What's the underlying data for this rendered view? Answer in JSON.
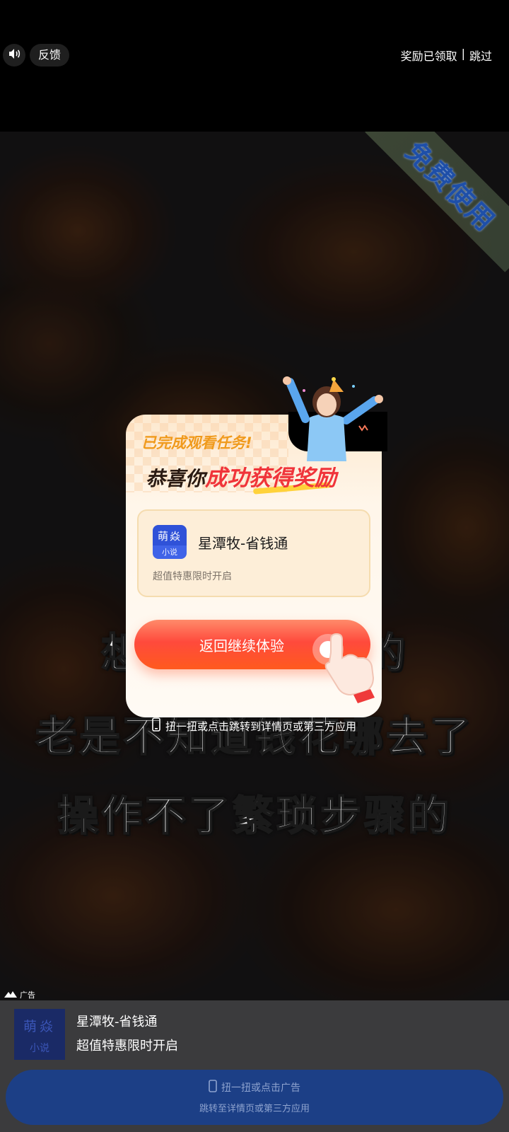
{
  "topbar": {
    "sound_icon": "speaker-icon",
    "feedback_label": "反馈",
    "reward_status": "奖励已领取",
    "separator": "|",
    "skip_label": "跳过"
  },
  "video": {
    "ribbon_text": "免费使用",
    "captions": [
      "想把钱存起来的",
      "老是不知道钱花哪去了",
      "操作不了繁琐步骤的"
    ],
    "hint": "扭一扭或点击跳转到详情页或第三方应用"
  },
  "popup": {
    "task_done": "已完成观看任务!",
    "congrats_prefix": "恭喜你",
    "congrats_highlight": "成功获得奖励",
    "app": {
      "icon_top": "萌焱",
      "icon_bottom": "小说",
      "name": "星潭牧-省钱通",
      "desc": "超值特惠限时开启"
    },
    "return_label": "返回继续体验"
  },
  "ad": {
    "label": "广告",
    "icon_top": "萌焱",
    "icon_bottom": "小说",
    "name": "星潭牧-省钱通",
    "desc": "超值特惠限时开启",
    "cta_line1": "扭一扭或点击广告",
    "cta_line2": "跳转至详情页或第三方应用"
  },
  "colors": {
    "accent_red": "#f0343a",
    "accent_orange": "#f09a1c",
    "cta_blue": "#1c3f86",
    "app_icon_blue": "#2f52d8"
  }
}
